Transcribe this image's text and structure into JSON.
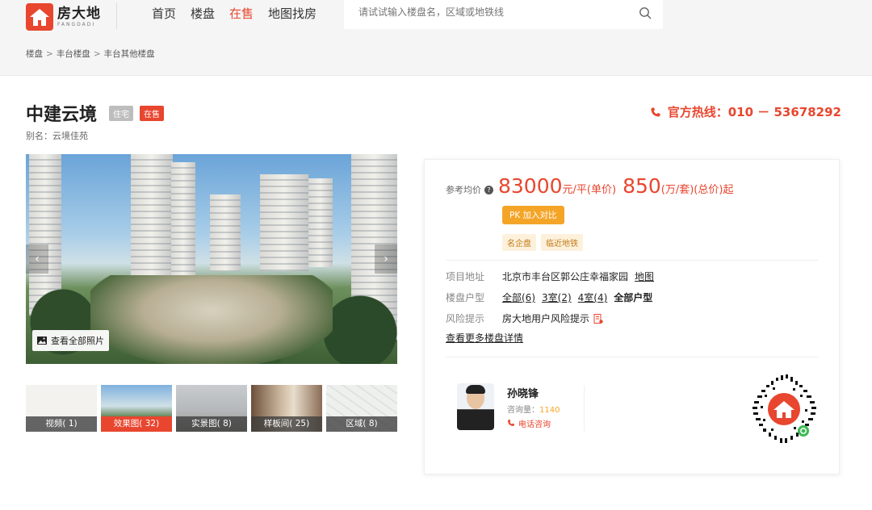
{
  "header": {
    "logo_cn": "房大地",
    "logo_en": "FANGDADI",
    "nav": [
      {
        "label": "首页",
        "active": false
      },
      {
        "label": "楼盘",
        "active": false
      },
      {
        "label": "在售",
        "active": true
      },
      {
        "label": "地图找房",
        "active": false
      }
    ],
    "search_placeholder": "请试试输入楼盘名，区域或地铁线"
  },
  "breadcrumb": [
    "楼盘",
    "丰台楼盘",
    "丰台其他楼盘"
  ],
  "project": {
    "title": "中建云境",
    "tag_type": "住宅",
    "tag_status": "在售",
    "alias": "别名：云境佳苑",
    "hotline_label": "官方热线：",
    "hotline_number": "010 － 53678292"
  },
  "gallery": {
    "prev_icon": "‹",
    "next_icon": "›",
    "view_all": "查看全部照片",
    "thumbs": [
      {
        "label": "视频( 1)",
        "active": false
      },
      {
        "label": "效果图( 32)",
        "active": true
      },
      {
        "label": "实景图( 8)",
        "active": false
      },
      {
        "label": "样板间( 25)",
        "active": false
      },
      {
        "label": "区域( 8)",
        "active": false
      }
    ]
  },
  "card": {
    "price_label": "参考均价",
    "price_help_icon": "?",
    "unit_price": "83000",
    "unit_price_suffix": "元/平(单价)",
    "total_price": "850",
    "total_price_suffix": "(万/套)(总价)起",
    "pk_label": "PK 加入对比",
    "feature_tags": [
      "名企盘",
      "临近地铁"
    ],
    "address_key": "项目地址",
    "address_val": "北京市丰台区郭公庄幸福家园",
    "map_link": "地图",
    "layout_key": "楼盘户型",
    "layouts": [
      "全部(6)",
      "3室(2)",
      "4室(4)"
    ],
    "layouts_all": "全部户型",
    "risk_key": "风险提示",
    "risk_val": "房大地用户风险提示",
    "more_link": "查看更多楼盘详情",
    "agent": {
      "name": "孙晓锋",
      "count_label": "咨询量：",
      "count": "1140",
      "call_label": "电话咨询"
    }
  },
  "colors": {
    "accent": "#e8462f",
    "orange": "#f4a528"
  }
}
